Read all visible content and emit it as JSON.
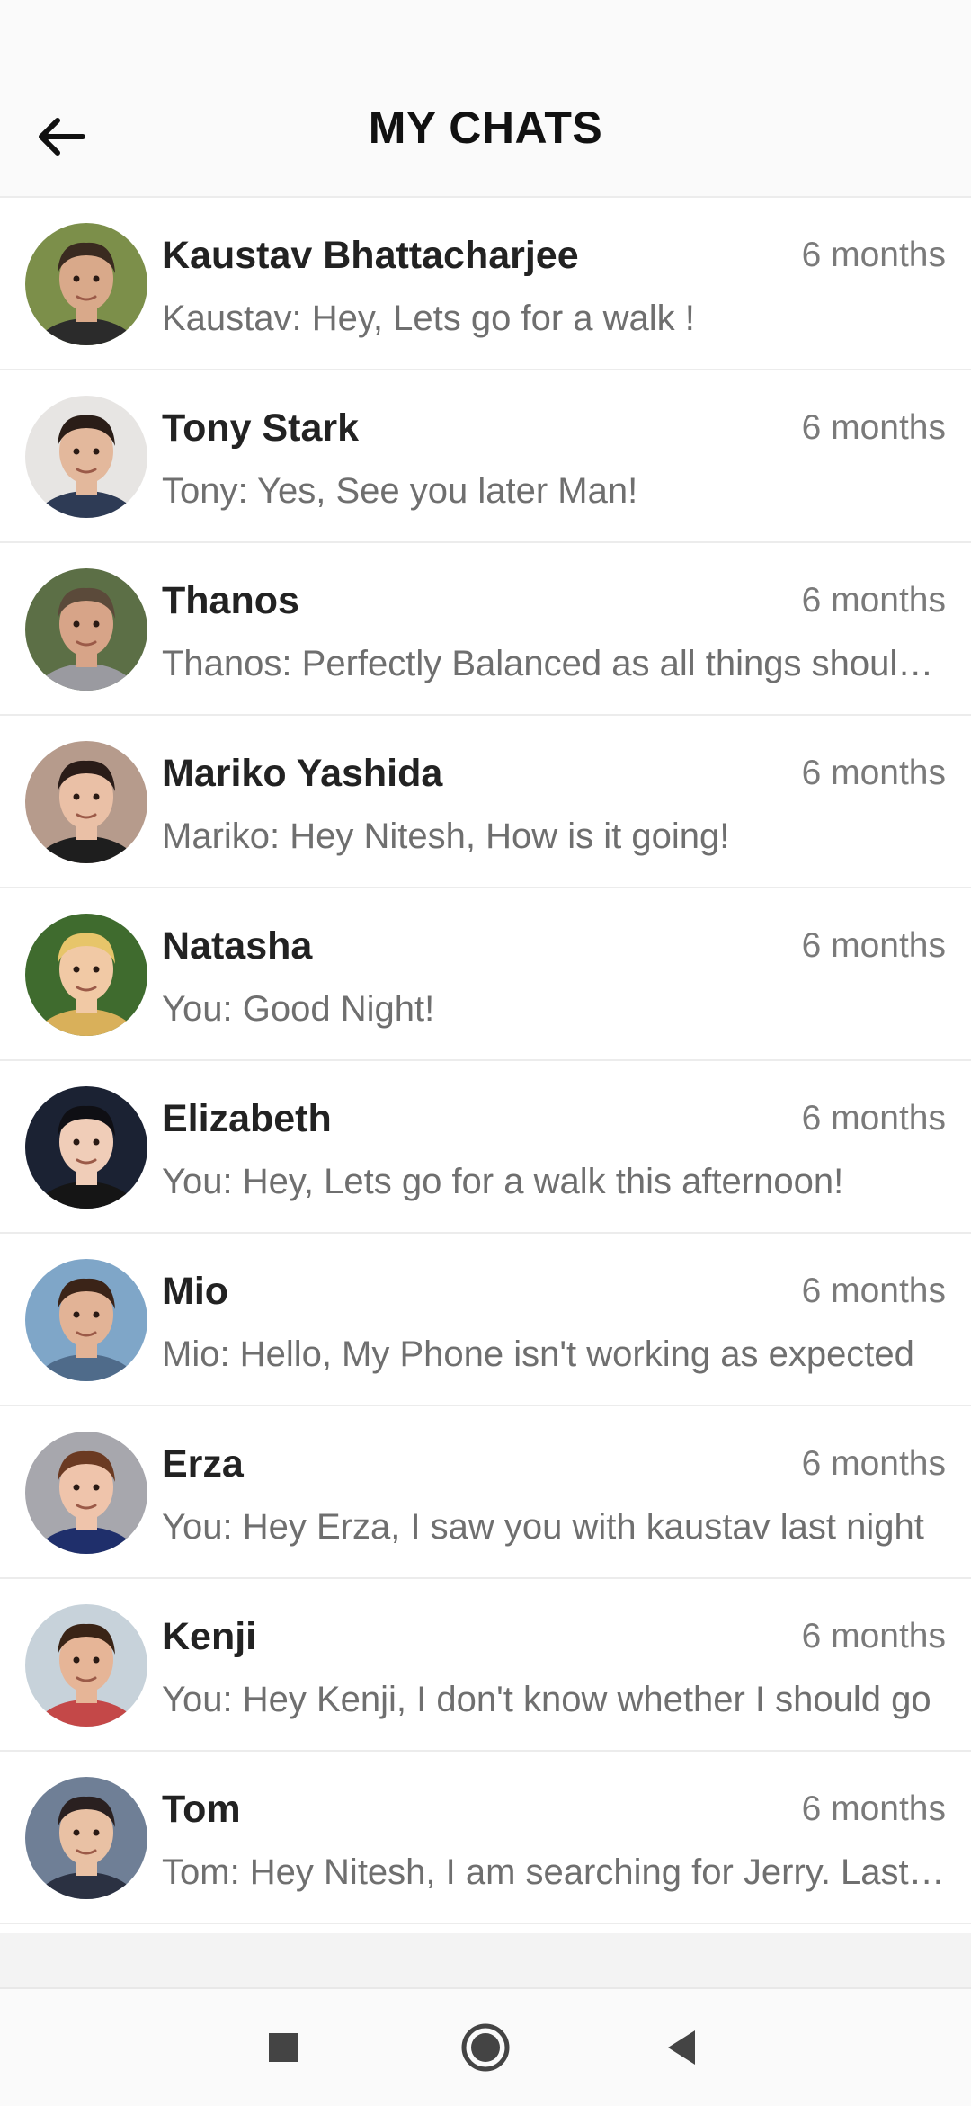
{
  "header": {
    "title": "MY CHATS",
    "back_icon": "arrow-left-icon"
  },
  "chats": [
    {
      "name": "Kaustav Bhattacharjee",
      "time": "6 months",
      "message": "Kaustav: Hey, Lets go for a walk !",
      "avatar": "avatar-man-beard",
      "bg": "#7c8f4a",
      "skin": "#d9a98a",
      "hair": "#3a2a20",
      "shirt": "#2b2b2b"
    },
    {
      "name": "Tony Stark",
      "time": "6 months",
      "message": "Tony: Yes, See you later Man!",
      "avatar": "avatar-man-dark-hair",
      "bg": "#e7e5e3",
      "skin": "#e3b89c",
      "hair": "#2a1d17",
      "shirt": "#2e3b55"
    },
    {
      "name": "Thanos",
      "time": "6 months",
      "message": "Thanos: Perfectly Balanced as all things should be",
      "avatar": "avatar-man-smiling",
      "bg": "#5c6f46",
      "skin": "#d7a488",
      "hair": "#5b4a3a",
      "shirt": "#9a9aa0"
    },
    {
      "name": "Mariko Yashida",
      "time": "6 months",
      "message": "Mariko: Hey Nitesh, How is it going!",
      "avatar": "avatar-woman-dark-hair",
      "bg": "#b69b8c",
      "skin": "#eac0a6",
      "hair": "#2a1c18",
      "shirt": "#1e1e1e"
    },
    {
      "name": "Natasha",
      "time": "6 months",
      "message": "You: Good Night!",
      "avatar": "avatar-woman-blonde",
      "bg": "#3f6b2e",
      "skin": "#f1c9a5",
      "hair": "#e7c56a",
      "shirt": "#d9b05a"
    },
    {
      "name": "Elizabeth",
      "time": "6 months",
      "message": "You: Hey, Lets go for a walk this afternoon!",
      "avatar": "avatar-woman-black-hair",
      "bg": "#1b2233",
      "skin": "#f0cdb8",
      "hair": "#0f0f14",
      "shirt": "#151515"
    },
    {
      "name": "Mio",
      "time": "6 months",
      "message": "Mio: Hello, My Phone isn't working as expected",
      "avatar": "avatar-woman-brown-hair",
      "bg": "#7fa6c8",
      "skin": "#e2b396",
      "hair": "#3b2418",
      "shirt": "#4f6b8a"
    },
    {
      "name": "Erza",
      "time": "6 months",
      "message": "You: Hey Erza, I saw you with kaustav last night",
      "avatar": "avatar-woman-auburn-hair",
      "bg": "#a7a7ad",
      "skin": "#efc4ab",
      "hair": "#6b3a22",
      "shirt": "#1f2f6b"
    },
    {
      "name": "Kenji",
      "time": "6 months",
      "message": "You: Hey Kenji, I don't know whether I should go",
      "avatar": "avatar-man-glasses",
      "bg": "#c7d2da",
      "skin": "#e6b597",
      "hair": "#3a2416",
      "shirt": "#c44848"
    },
    {
      "name": "Tom",
      "time": "6 months",
      "message": "Tom: Hey Nitesh, I am searching for Jerry. Last seen",
      "avatar": "avatar-man-suit",
      "bg": "#6f7f96",
      "skin": "#e9c1a4",
      "hair": "#2a2020",
      "shirt": "#2b3142"
    }
  ],
  "navbar": {
    "icons": [
      "square-icon",
      "circle-home-icon",
      "triangle-back-icon"
    ]
  }
}
